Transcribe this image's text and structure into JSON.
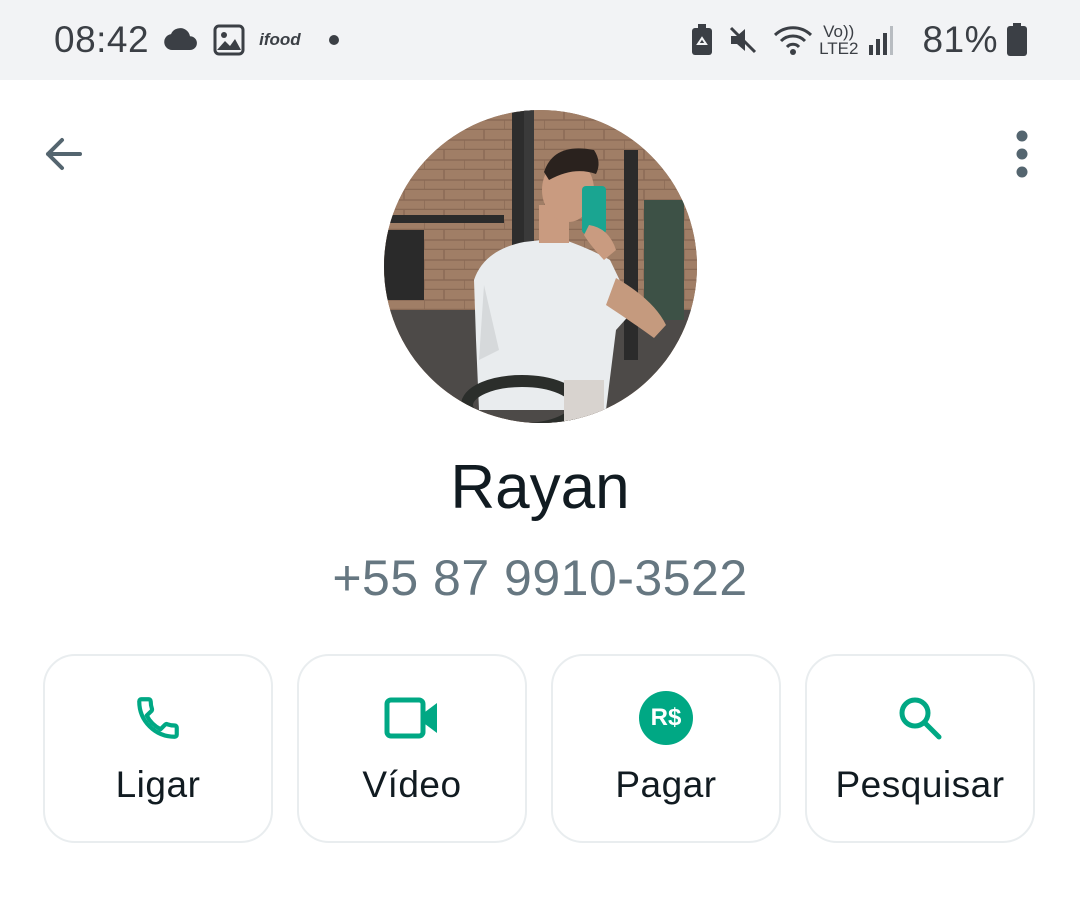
{
  "status_bar": {
    "time": "08:42",
    "notification_icons": [
      "cloud-icon",
      "gallery-icon",
      "ifood-icon",
      "dot-icon"
    ],
    "ifood_label": "ifood",
    "volte_top": "Vo))",
    "volte_bottom": "LTE2",
    "battery_percent": "81%",
    "system_icons": [
      "battery-saver-icon",
      "mute-icon",
      "wifi-icon",
      "signal-icon",
      "battery-icon"
    ]
  },
  "header": {
    "back_icon": "arrow-left-icon",
    "menu_icon": "more-vertical-icon"
  },
  "contact": {
    "name": "Rayan",
    "phone": "+55 87 9910-3522"
  },
  "actions": [
    {
      "label": "Ligar",
      "icon": "phone-icon"
    },
    {
      "label": "Vídeo",
      "icon": "video-icon"
    },
    {
      "label": "Pagar",
      "icon": "payment-icon",
      "icon_text": "R$"
    },
    {
      "label": "Pesquisar",
      "icon": "search-icon"
    }
  ],
  "colors": {
    "accent": "#00a884",
    "status_bar_bg": "#f2f3f5",
    "muted_text": "#667781"
  }
}
